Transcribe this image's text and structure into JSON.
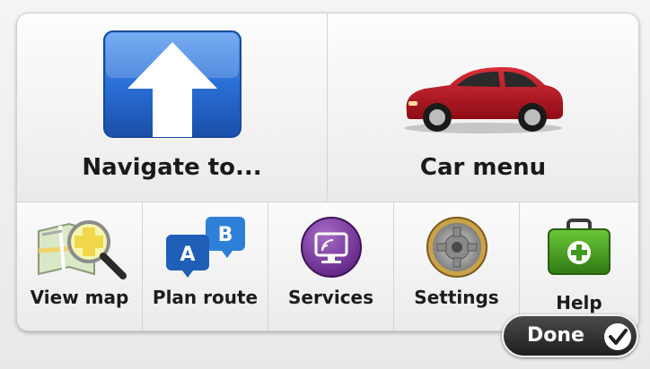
{
  "main_menu": {
    "navigate_label": "Navigate to...",
    "car_menu_label": "Car menu"
  },
  "shortcuts": {
    "view_map_label": "View map",
    "plan_route_label": "Plan route",
    "services_label": "Services",
    "settings_label": "Settings",
    "help_label": "Help"
  },
  "route_badges": {
    "a": "A",
    "b": "B"
  },
  "done_label": "Done",
  "colors": {
    "navigate_blue": "#1e63c8",
    "car_red": "#b5121b",
    "services_purple": "#6b2a8e",
    "help_green": "#3f9a1f",
    "done_bg": "#2a2a2a"
  },
  "icons": {
    "navigate": "up-arrow-icon",
    "car": "car-icon",
    "view_map": "map-magnifier-icon",
    "plan_route": "route-ab-icon",
    "services": "services-monitor-icon",
    "settings": "gear-icon",
    "help": "first-aid-kit-icon",
    "done": "checkmark-icon"
  }
}
